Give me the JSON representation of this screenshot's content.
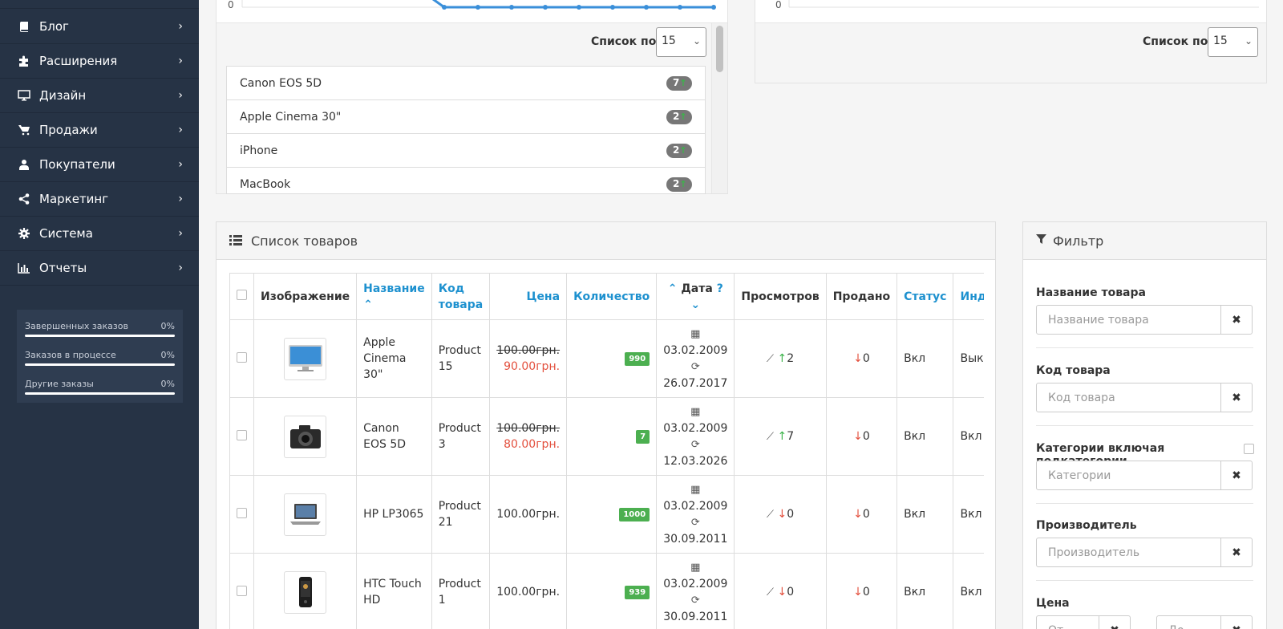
{
  "sidebar": {
    "items": [
      {
        "label": "Блог",
        "icon": "book-icon"
      },
      {
        "label": "Расширения",
        "icon": "puzzle-icon"
      },
      {
        "label": "Дизайн",
        "icon": "desktop-icon"
      },
      {
        "label": "Продажи",
        "icon": "cart-icon"
      },
      {
        "label": "Покупатели",
        "icon": "user-icon"
      },
      {
        "label": "Маркетинг",
        "icon": "share-icon"
      },
      {
        "label": "Система",
        "icon": "cog-icon"
      },
      {
        "label": "Отчеты",
        "icon": "bar-chart-icon"
      }
    ],
    "stats": [
      {
        "name": "Завершенных заказов",
        "pct": "0%"
      },
      {
        "name": "Заказов в процессе",
        "pct": "0%"
      },
      {
        "name": "Другие заказы",
        "pct": "0%"
      }
    ]
  },
  "top_left": {
    "zero_label": "0",
    "list_by_label": "Список по:",
    "list_by_value": "15",
    "items": [
      {
        "name": "Canon EOS 5D",
        "count": "7"
      },
      {
        "name": "Apple Cinema 30\"",
        "count": "2"
      },
      {
        "name": "iPhone",
        "count": "2"
      },
      {
        "name": "MacBook",
        "count": "2"
      }
    ]
  },
  "top_right": {
    "zero_label": "0",
    "list_by_label": "Список по:",
    "list_by_value": "15"
  },
  "products": {
    "title": "Список товаров",
    "headers": {
      "image": "Изображение",
      "name": "Название",
      "code": "Код товара",
      "price": "Цена",
      "quantity": "Количество",
      "date": "Дата",
      "views": "Просмотров",
      "sold": "Продано",
      "status": "Статус",
      "index": "Индекс",
      "cut": "Д"
    },
    "rows": [
      {
        "name": "Apple Cinema 30\"",
        "code": "Product 15",
        "old_price": "100.00грн.",
        "price": "90.00грн.",
        "qty": "990",
        "date_added": "03.02.2009",
        "date_modified": "26.07.2017",
        "views": "2",
        "views_trend": "up",
        "sold": "0",
        "status": "Вкл",
        "index": "Выкл"
      },
      {
        "name": "Canon EOS 5D",
        "code": "Product 3",
        "old_price": "100.00грн.",
        "price": "80.00грн.",
        "qty": "7",
        "date_added": "03.02.2009",
        "date_modified": "12.03.2026",
        "views": "7",
        "views_trend": "up",
        "sold": "0",
        "status": "Вкл",
        "index": "Вкл"
      },
      {
        "name": "HP LP3065",
        "code": "Product 21",
        "old_price": "",
        "price": "100.00грн.",
        "qty": "1000",
        "date_added": "03.02.2009",
        "date_modified": "30.09.2011",
        "views": "0",
        "views_trend": "down",
        "sold": "0",
        "status": "Вкл",
        "index": "Вкл"
      },
      {
        "name": "HTC Touch HD",
        "code": "Product 1",
        "old_price": "",
        "price": "100.00грн.",
        "qty": "939",
        "date_added": "03.02.2009",
        "date_modified": "30.09.2011",
        "views": "0",
        "views_trend": "down",
        "sold": "0",
        "status": "Вкл",
        "index": "Вкл"
      }
    ]
  },
  "filter": {
    "title": "Фильтр",
    "name_label": "Название товара",
    "name_placeholder": "Название товара",
    "code_label": "Код товара",
    "code_placeholder": "Код товара",
    "category_label": "Категории включая подкатегории",
    "category_placeholder": "Категории",
    "manufacturer_label": "Производитель",
    "manufacturer_placeholder": "Производитель",
    "price_label": "Цена",
    "price_from_placeholder": "От",
    "price_to_placeholder": "До"
  },
  "colors": {
    "sidebar_bg": "#263345",
    "link_blue": "#1e91cf",
    "qty_green": "#4caf50",
    "sale_red": "#e3503e",
    "chart_line": "#3a8fd9"
  }
}
